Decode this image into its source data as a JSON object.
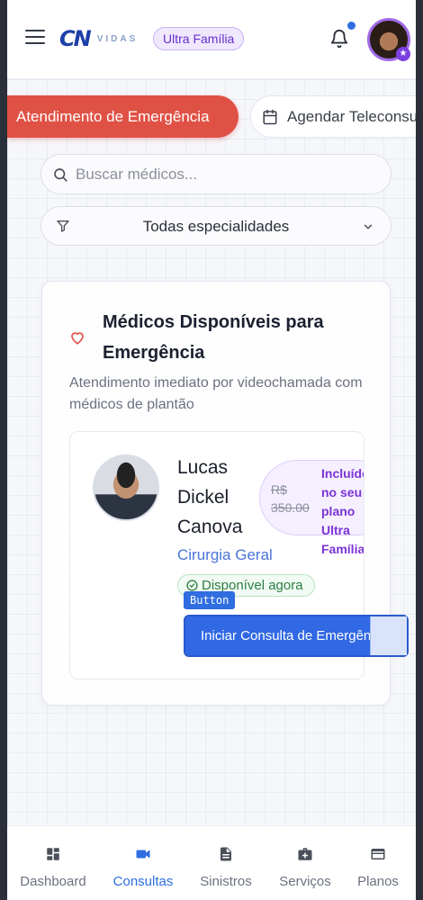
{
  "header": {
    "logo_main": "CN",
    "logo_sub": "VIDAS",
    "plan_badge": "Ultra Família"
  },
  "tabs": [
    {
      "label": "Atendimento de Emergência",
      "active": true
    },
    {
      "label": "Agendar Teleconsulta",
      "active": false
    }
  ],
  "search": {
    "placeholder": "Buscar médicos...",
    "value": ""
  },
  "filter": {
    "selected": "Todas especialidades"
  },
  "emergency": {
    "title": "Médicos Disponíveis para Emergência",
    "subtitle": "Atendimento imediato por videochamada com médicos de plantão",
    "doctor": {
      "name": "Lucas Dickel Canova",
      "specialty": "Cirurgia Geral",
      "price_old": "R$ 350.00",
      "price_included": "Incluído no seu plano Ultra Família",
      "availability": "Disponível agora",
      "action_label": "Iniciar Consulta de Emergência",
      "tag": "Button"
    }
  },
  "bottom_nav": [
    {
      "label": "Dashboard",
      "icon": "dashboard-icon",
      "active": false
    },
    {
      "label": "Consultas",
      "icon": "video-camera-icon",
      "active": true
    },
    {
      "label": "Sinistros",
      "icon": "document-icon",
      "active": false
    },
    {
      "label": "Serviços",
      "icon": "medical-bag-icon",
      "active": false
    },
    {
      "label": "Planos",
      "icon": "credit-card-icon",
      "active": false
    }
  ],
  "colors": {
    "accent": "#2f6de0",
    "emergency": "#e05145",
    "plan_purple": "#7b33d6",
    "available_green": "#2e7d45"
  }
}
